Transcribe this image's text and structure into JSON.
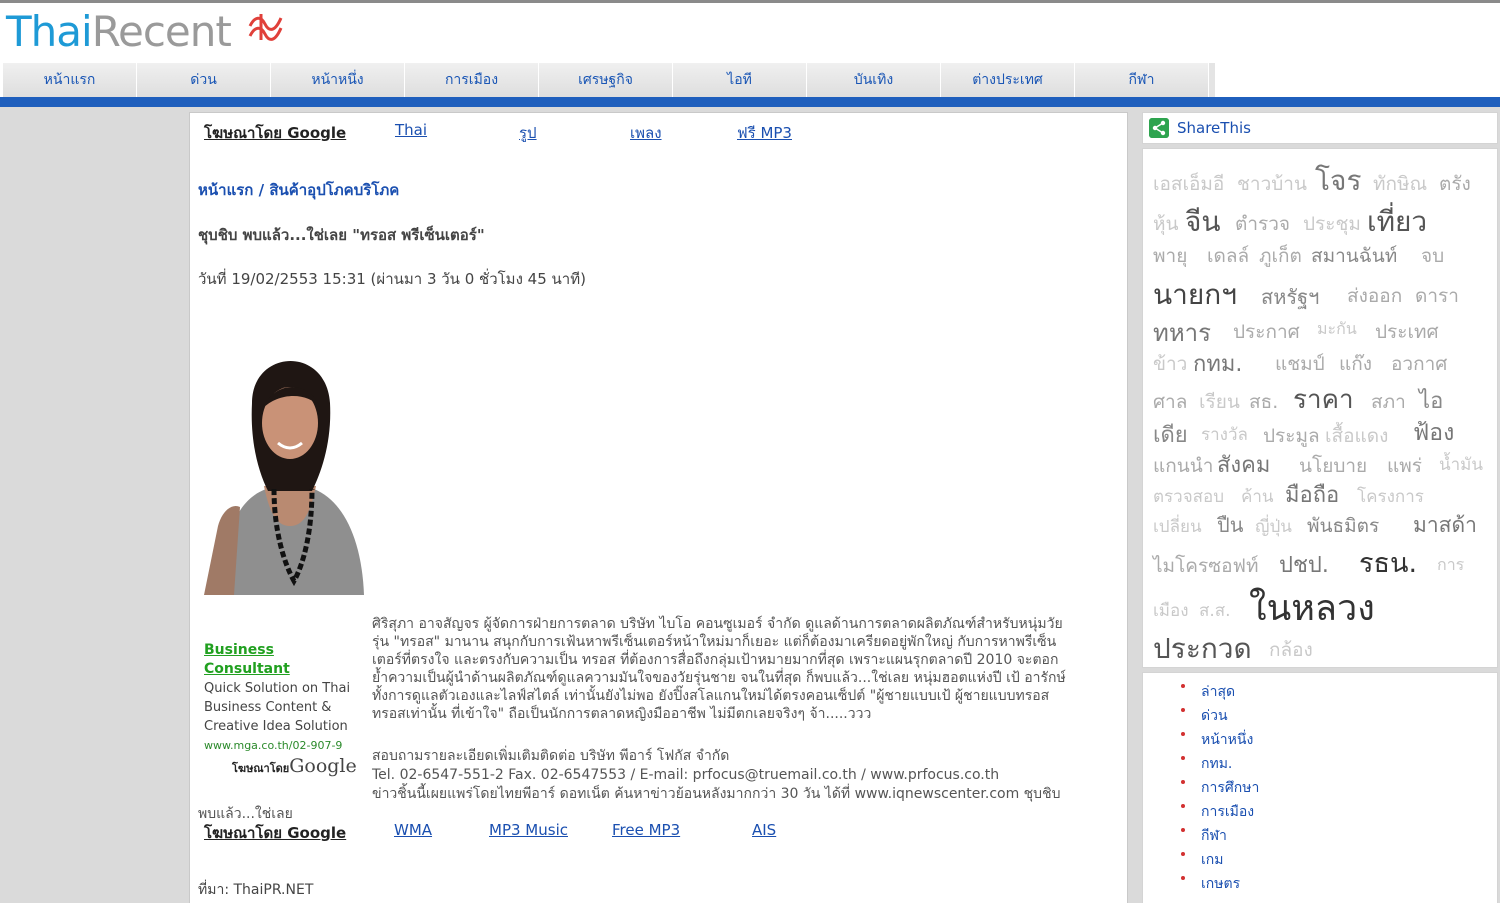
{
  "site": {
    "logo_thai": "Thai",
    "logo_recent": "Recent"
  },
  "nav": [
    "หน้าแรก",
    "ด่วน",
    "หน้าหนึ่ง",
    "การเมือง",
    "เศรษฐกิจ",
    "ไอที",
    "บันเทิง",
    "ต่างประเทศ",
    "กีฬา"
  ],
  "ads_top": {
    "label": "โฆษณาโดย Google",
    "links": [
      "Thai",
      "รูป",
      "เพลง",
      "ฟรี MP3"
    ]
  },
  "breadcrumb": {
    "home": "หน้าแรก",
    "sep": " / ",
    "category": "สินค้าอุปโภคบริโภค"
  },
  "article": {
    "headline": "ชุบชิบ พบแล้ว...ใช่เลย \"ทรอส พรีเซ็นเตอร์\"",
    "dateline": "วันที่ 19/02/2553 15:31 (ผ่านมา 3 วัน 0 ชั่วโมง 45 นาที)",
    "body": [
      "ศิริสุภา อาจสัญจร ผู้จัดการฝ่ายการตลาด บริษัท ไบโอ คอนซูเมอร์ จำกัด ดูแลด้านการตลาดผลิตภัณฑ์สำหรับหนุ่มวัย",
      "รุ่น \"ทรอส\" มานาน สนุกกับการเฟ้นหาพรีเซ็นเตอร์หน้าใหม่มาก็เยอะ แต่ก็ต้องมาเครียดอยู่พักใหญ่ กับการหาพรีเซ็น",
      "เตอร์ที่ตรงใจ และตรงกับความเป็น ทรอส ที่ต้องการสื่อถึงกลุ่มเป้าหมายมากที่สุด เพราะแผนรุกตลาดปี 2010 จะตอก",
      "ย้ำความเป็นผู้นำด้านผลิตภัณฑ์ดูแลความมันใจของวัยรุ่นชาย จนในที่สุด ก็พบแล้ว...ใช่เลย หนุ่มฮอตแห่งปี เป้ อารักษ์",
      "ทั้งการดูแลตัวเองและไลฟ์สไตล์ เท่านั้นยังไม่พอ ยังปิ๊งสโลแกนใหม่ได้ตรงคอนเซ็ปต์ \"ผู้ชายแบบเป้ ผู้ชายแบบทรอส",
      "ทรอสเท่านั้น ที่เข้าใจ\" ถือเป็นนักการตลาดหญิงมืออาชีพ ไม่มีตกเลยจริงๆ จ้า.....ววว"
    ],
    "contact": [
      "สอบถามรายละเอียดเพิ่มเติมติดต่อ บริษัท พีอาร์ โฟกัส จำกัด",
      "Tel. 02-6547-551-2 Fax. 02-6547553 / E-mail: prfocus@truemail.co.th / www.prfocus.co.th",
      "ข่าวชิ้นนี้เผยแพร่โดยไทยพีอาร์ ดอทเน็ต ค้นหาข่าวย้อนหลังมากกว่า 30 วัน ได้ที่ www.iqnewscenter.com ชุบชิบ"
    ],
    "body_tail": "พบแล้ว...ใช่เลย",
    "source": "ที่มา: ThaiPR.NET"
  },
  "ad_box": {
    "title": "Business Consultant",
    "lines": [
      "Quick Solution on Thai",
      "Business Content &",
      "Creative Idea Solution"
    ],
    "url": "www.mga.co.th/02-907-9",
    "adsby_label": "โฆษณาโดย",
    "adsby_brand": "Google"
  },
  "ads_bottom": {
    "label": "โฆษณาโดย Google",
    "links": [
      "WMA",
      "MP3 Music",
      "Free MP3",
      "AIS"
    ]
  },
  "share": {
    "label": "ShareThis"
  },
  "tag_cloud": [
    "เอสเอ็มอี",
    "ชาวบ้าน",
    "โจร",
    "ทักษิณ",
    "ตรัง",
    "หุ้น",
    "จีน",
    "ตำรวจ",
    "ประชุม",
    "เที่ยว",
    "พายุ",
    "เดลล์",
    "ภูเก็ต",
    "สมานฉันท์",
    "จบ",
    "นายกฯ",
    "สหรัฐฯ",
    "ส่งออก",
    "ดารา",
    "ทหาร",
    "ประกาศ",
    "มะกัน",
    "ประเทศ",
    "ข้าว",
    "กทม.",
    "แชมป์",
    "แก๊ง",
    "อวกาศ",
    "ศาล",
    "เรียน",
    "สธ.",
    "ราคา",
    "สภา",
    "ไอ",
    "เดีย",
    "รางวัล",
    "ประมูล",
    "เสื้อแดง",
    "ฟ้อง",
    "แกนนำ",
    "สังคม",
    "นโยบาย",
    "แพร่",
    "น้ำมัน",
    "ตรวจสอบ",
    "ค้าน",
    "มือถือ",
    "โครงการ",
    "เปลี่ยน",
    "ปืน",
    "ญี่ปุ่น",
    "พันธมิตร",
    "มาสด้า",
    "ไมโครซอฟท์",
    "ปชป.",
    "รธน.",
    "การ",
    "เมือง",
    "ส.ส.",
    "ในหลวง",
    "ประกวด",
    "กล้อง"
  ],
  "categories": [
    "ล่าสุด",
    "ด่วน",
    "หน้าหนึ่ง",
    "กทม.",
    "การศึกษา",
    "การเมือง",
    "กีฬา",
    "เกม",
    "เกษตร"
  ]
}
